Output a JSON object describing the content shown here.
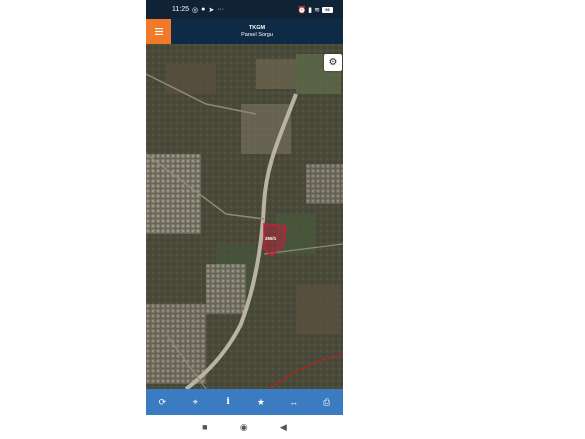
{
  "status_bar": {
    "time": "11:25",
    "battery": "56"
  },
  "header": {
    "title": "TKGM",
    "subtitle": "Parsel Sorgu",
    "menu_icon": "hamburger-menu-icon"
  },
  "map": {
    "parcel_label": "269/1",
    "parcel_color": "#c0203a",
    "boundary_color": "#d01818"
  },
  "settings": {
    "icon": "gear-icon"
  },
  "toolbar": {
    "color": "#3b7bc2",
    "items": [
      {
        "name": "refresh",
        "glyph": "⟳"
      },
      {
        "name": "locate",
        "glyph": "⌖"
      },
      {
        "name": "info",
        "glyph": "i"
      },
      {
        "name": "favorite",
        "glyph": "★"
      },
      {
        "name": "measure",
        "glyph": "↔"
      },
      {
        "name": "print",
        "glyph": "⎙"
      }
    ]
  },
  "nav": {
    "recent": "■",
    "home": "◉",
    "back": "◀"
  }
}
